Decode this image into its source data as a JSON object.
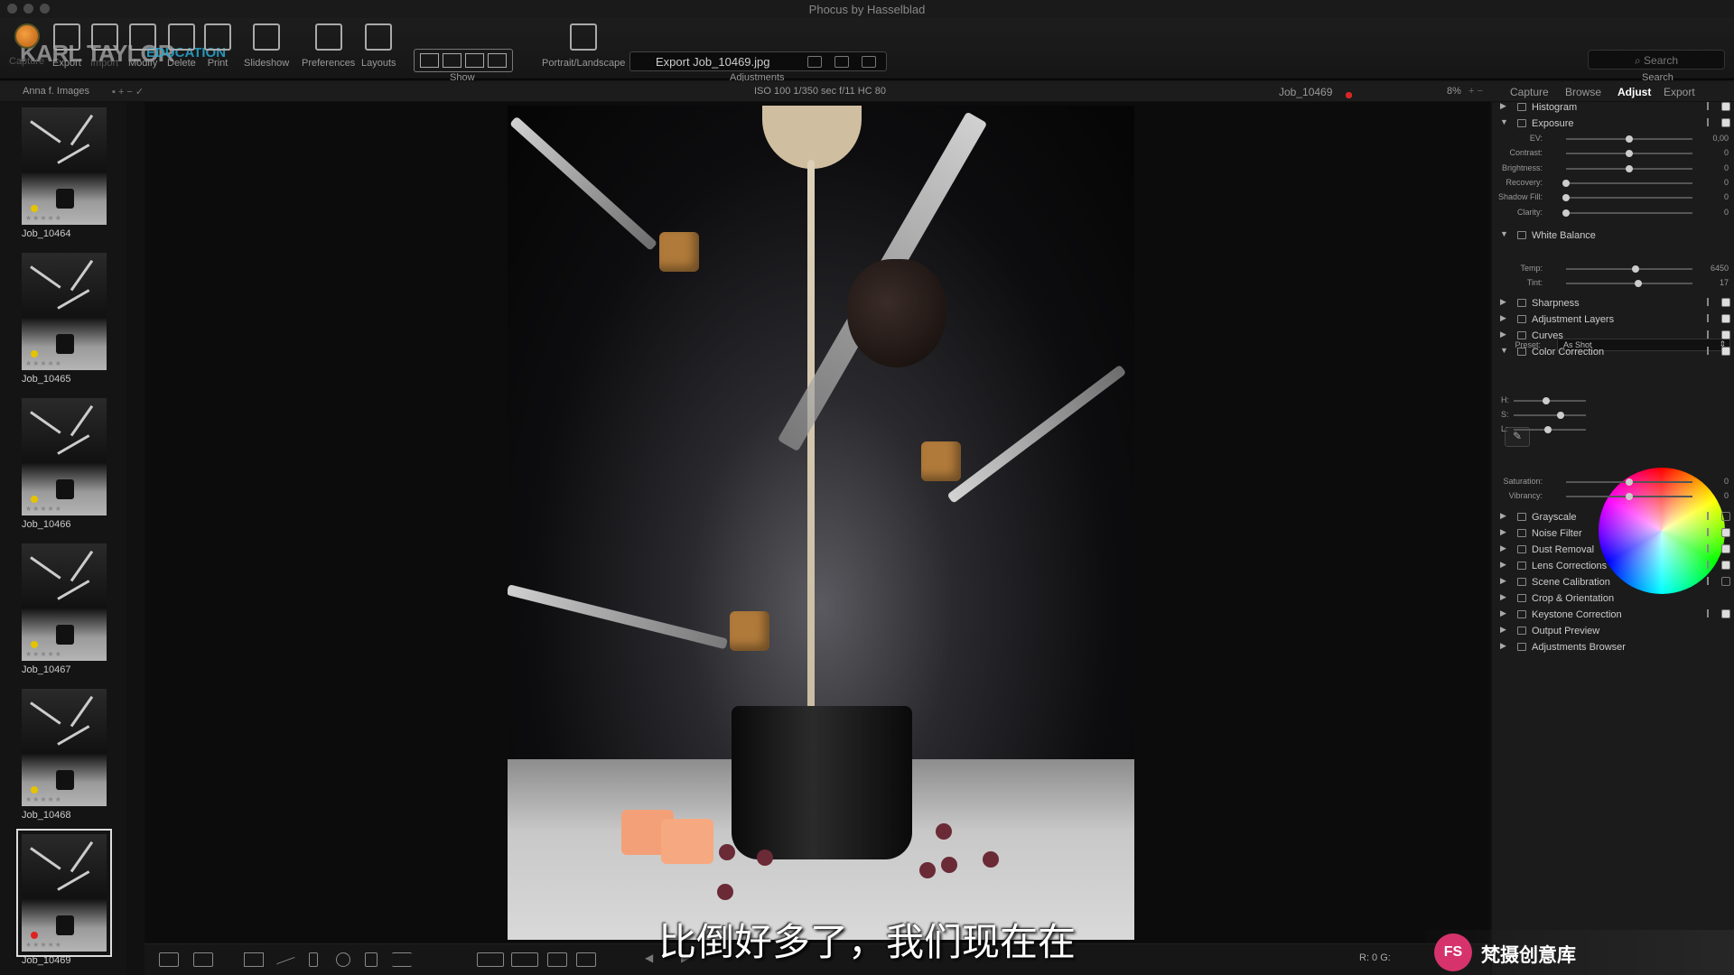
{
  "window": {
    "title": "Phocus by Hasselblad"
  },
  "brand": {
    "text": "KARL TAYLOR",
    "sub": "EDUCATION"
  },
  "toolbar": {
    "items": [
      {
        "label": "Capture",
        "icon": "capture-icon",
        "dim": true
      },
      {
        "label": "Export",
        "icon": "export-icon",
        "dim": false
      },
      {
        "label": "Import",
        "icon": "import-icon",
        "dim": true
      },
      {
        "label": "Modify",
        "icon": "modify-icon",
        "dim": false
      },
      {
        "label": "Delete",
        "icon": "delete-icon",
        "dim": false
      },
      {
        "label": "Print",
        "icon": "print-icon",
        "dim": false
      },
      {
        "label": "Slideshow",
        "icon": "slideshow-icon",
        "dim": false
      },
      {
        "label": "Preferences",
        "icon": "preferences-icon",
        "dim": false
      },
      {
        "label": "Layouts",
        "icon": "layouts-icon",
        "dim": false
      }
    ],
    "show_label": "Show",
    "portrait_label": "Portrait/Landscape",
    "export_field": "Export Job_10469.jpg",
    "adjustments_label": "Adjustments",
    "search_placeholder": "Search",
    "search_label": "Search"
  },
  "subheader": {
    "folder": "Anna f. Images",
    "exif": "ISO 100   1/350 sec   f/11   HC 80",
    "filename": "Job_10469",
    "zoom": "8%",
    "tabs": [
      "Capture",
      "Browse",
      "Adjust",
      "Export"
    ],
    "active_tab": "Adjust"
  },
  "filmstrip": [
    {
      "label": "Job_10464",
      "flag": "yellow"
    },
    {
      "label": "Job_10465",
      "flag": "yellow"
    },
    {
      "label": "Job_10466",
      "flag": "yellow"
    },
    {
      "label": "Job_10467",
      "flag": "yellow"
    },
    {
      "label": "Job_10468",
      "flag": "yellow"
    },
    {
      "label": "Job_10469",
      "flag": "red",
      "selected": true
    }
  ],
  "panel": {
    "histogram": "Histogram",
    "exposure": {
      "title": "Exposure",
      "sliders": [
        {
          "label": "EV:",
          "value": "0,00",
          "pos": 0.5
        },
        {
          "label": "Contrast:",
          "value": "0",
          "pos": 0.5
        },
        {
          "label": "Brightness:",
          "value": "0",
          "pos": 0.5
        },
        {
          "label": "Recovery:",
          "value": "0",
          "pos": 0.0
        },
        {
          "label": "Shadow Fill:",
          "value": "0",
          "pos": 0.0
        },
        {
          "label": "Clarity:",
          "value": "0",
          "pos": 0.0
        }
      ]
    },
    "white_balance": {
      "title": "White Balance",
      "preset_label": "Preset:",
      "preset_value": "As Shot",
      "sliders": [
        {
          "label": "Temp:",
          "value": "6450",
          "pos": 0.55
        },
        {
          "label": "Tint:",
          "value": "17",
          "pos": 0.57
        }
      ]
    },
    "mid_sections": [
      {
        "name": "Sharpness",
        "checked": true
      },
      {
        "name": "Adjustment Layers",
        "checked": true
      },
      {
        "name": "Curves",
        "checked": true
      }
    ],
    "color_correction": {
      "title": "Color Correction",
      "hsl": [
        {
          "label": "H:",
          "pos": 0.45
        },
        {
          "label": "S:",
          "pos": 0.65
        },
        {
          "label": "L:",
          "pos": 0.48
        }
      ],
      "sliders": [
        {
          "label": "Saturation:",
          "value": "0",
          "pos": 0.5
        },
        {
          "label": "Vibrancy:",
          "value": "0",
          "pos": 0.5
        }
      ]
    },
    "lower_sections": [
      {
        "name": "Grayscale",
        "checked": false,
        "opts": true
      },
      {
        "name": "Noise Filter",
        "checked": true,
        "opts": true
      },
      {
        "name": "Dust Removal",
        "checked": true,
        "opts": true
      },
      {
        "name": "Lens Corrections",
        "checked": true,
        "opts": true
      },
      {
        "name": "Scene Calibration",
        "checked": false,
        "opts": true
      },
      {
        "name": "Crop & Orientation",
        "checked": null,
        "opts": false
      },
      {
        "name": "Keystone Correction",
        "checked": true,
        "opts": true
      },
      {
        "name": "Output Preview",
        "checked": null,
        "opts": false
      },
      {
        "name": "Adjustments Browser",
        "checked": null,
        "opts": false
      }
    ]
  },
  "bottombar": {
    "readout": "R:   0  G:"
  },
  "subtitle": "比倒好多了，我们现在在",
  "watermark": {
    "logo": "FS",
    "text": "梵摄创意库"
  },
  "colors": {
    "selected_flag": "#d22",
    "yellow_flag": "#e6c300",
    "accent_brand": "#28aad2"
  }
}
